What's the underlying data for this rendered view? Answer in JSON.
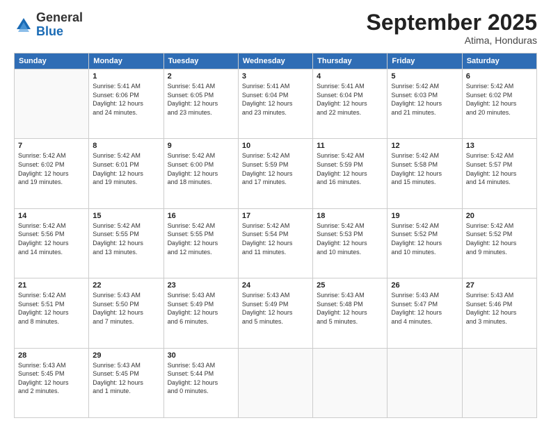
{
  "logo": {
    "general": "General",
    "blue": "Blue"
  },
  "header": {
    "month": "September 2025",
    "location": "Atima, Honduras"
  },
  "days_of_week": [
    "Sunday",
    "Monday",
    "Tuesday",
    "Wednesday",
    "Thursday",
    "Friday",
    "Saturday"
  ],
  "weeks": [
    [
      {
        "day": "",
        "info": ""
      },
      {
        "day": "1",
        "info": "Sunrise: 5:41 AM\nSunset: 6:06 PM\nDaylight: 12 hours\nand 24 minutes."
      },
      {
        "day": "2",
        "info": "Sunrise: 5:41 AM\nSunset: 6:05 PM\nDaylight: 12 hours\nand 23 minutes."
      },
      {
        "day": "3",
        "info": "Sunrise: 5:41 AM\nSunset: 6:04 PM\nDaylight: 12 hours\nand 23 minutes."
      },
      {
        "day": "4",
        "info": "Sunrise: 5:41 AM\nSunset: 6:04 PM\nDaylight: 12 hours\nand 22 minutes."
      },
      {
        "day": "5",
        "info": "Sunrise: 5:42 AM\nSunset: 6:03 PM\nDaylight: 12 hours\nand 21 minutes."
      },
      {
        "day": "6",
        "info": "Sunrise: 5:42 AM\nSunset: 6:02 PM\nDaylight: 12 hours\nand 20 minutes."
      }
    ],
    [
      {
        "day": "7",
        "info": "Sunrise: 5:42 AM\nSunset: 6:02 PM\nDaylight: 12 hours\nand 19 minutes."
      },
      {
        "day": "8",
        "info": "Sunrise: 5:42 AM\nSunset: 6:01 PM\nDaylight: 12 hours\nand 19 minutes."
      },
      {
        "day": "9",
        "info": "Sunrise: 5:42 AM\nSunset: 6:00 PM\nDaylight: 12 hours\nand 18 minutes."
      },
      {
        "day": "10",
        "info": "Sunrise: 5:42 AM\nSunset: 5:59 PM\nDaylight: 12 hours\nand 17 minutes."
      },
      {
        "day": "11",
        "info": "Sunrise: 5:42 AM\nSunset: 5:59 PM\nDaylight: 12 hours\nand 16 minutes."
      },
      {
        "day": "12",
        "info": "Sunrise: 5:42 AM\nSunset: 5:58 PM\nDaylight: 12 hours\nand 15 minutes."
      },
      {
        "day": "13",
        "info": "Sunrise: 5:42 AM\nSunset: 5:57 PM\nDaylight: 12 hours\nand 14 minutes."
      }
    ],
    [
      {
        "day": "14",
        "info": "Sunrise: 5:42 AM\nSunset: 5:56 PM\nDaylight: 12 hours\nand 14 minutes."
      },
      {
        "day": "15",
        "info": "Sunrise: 5:42 AM\nSunset: 5:55 PM\nDaylight: 12 hours\nand 13 minutes."
      },
      {
        "day": "16",
        "info": "Sunrise: 5:42 AM\nSunset: 5:55 PM\nDaylight: 12 hours\nand 12 minutes."
      },
      {
        "day": "17",
        "info": "Sunrise: 5:42 AM\nSunset: 5:54 PM\nDaylight: 12 hours\nand 11 minutes."
      },
      {
        "day": "18",
        "info": "Sunrise: 5:42 AM\nSunset: 5:53 PM\nDaylight: 12 hours\nand 10 minutes."
      },
      {
        "day": "19",
        "info": "Sunrise: 5:42 AM\nSunset: 5:52 PM\nDaylight: 12 hours\nand 10 minutes."
      },
      {
        "day": "20",
        "info": "Sunrise: 5:42 AM\nSunset: 5:52 PM\nDaylight: 12 hours\nand 9 minutes."
      }
    ],
    [
      {
        "day": "21",
        "info": "Sunrise: 5:42 AM\nSunset: 5:51 PM\nDaylight: 12 hours\nand 8 minutes."
      },
      {
        "day": "22",
        "info": "Sunrise: 5:43 AM\nSunset: 5:50 PM\nDaylight: 12 hours\nand 7 minutes."
      },
      {
        "day": "23",
        "info": "Sunrise: 5:43 AM\nSunset: 5:49 PM\nDaylight: 12 hours\nand 6 minutes."
      },
      {
        "day": "24",
        "info": "Sunrise: 5:43 AM\nSunset: 5:49 PM\nDaylight: 12 hours\nand 5 minutes."
      },
      {
        "day": "25",
        "info": "Sunrise: 5:43 AM\nSunset: 5:48 PM\nDaylight: 12 hours\nand 5 minutes."
      },
      {
        "day": "26",
        "info": "Sunrise: 5:43 AM\nSunset: 5:47 PM\nDaylight: 12 hours\nand 4 minutes."
      },
      {
        "day": "27",
        "info": "Sunrise: 5:43 AM\nSunset: 5:46 PM\nDaylight: 12 hours\nand 3 minutes."
      }
    ],
    [
      {
        "day": "28",
        "info": "Sunrise: 5:43 AM\nSunset: 5:45 PM\nDaylight: 12 hours\nand 2 minutes."
      },
      {
        "day": "29",
        "info": "Sunrise: 5:43 AM\nSunset: 5:45 PM\nDaylight: 12 hours\nand 1 minute."
      },
      {
        "day": "30",
        "info": "Sunrise: 5:43 AM\nSunset: 5:44 PM\nDaylight: 12 hours\nand 0 minutes."
      },
      {
        "day": "",
        "info": ""
      },
      {
        "day": "",
        "info": ""
      },
      {
        "day": "",
        "info": ""
      },
      {
        "day": "",
        "info": ""
      }
    ]
  ]
}
